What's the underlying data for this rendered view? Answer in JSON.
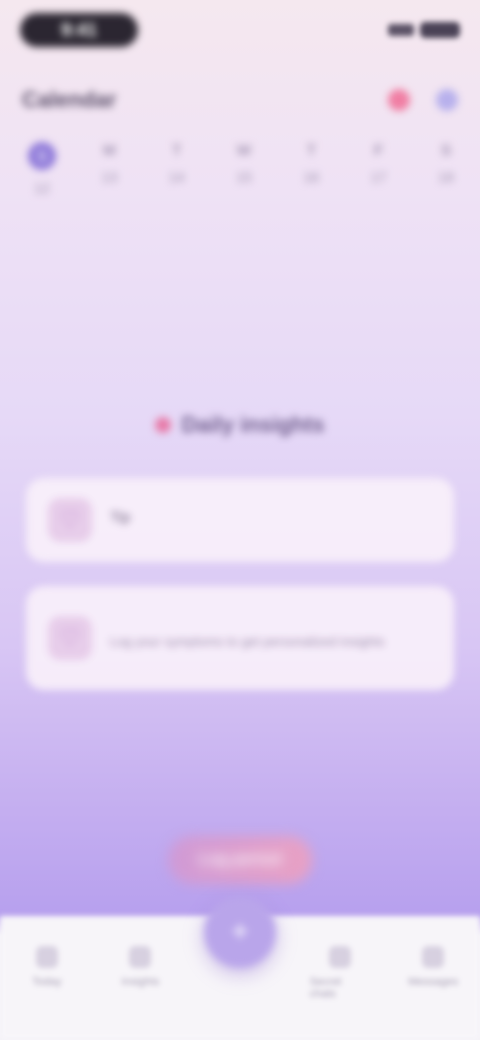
{
  "status_bar": {
    "time": "9:41"
  },
  "header": {
    "title": "Calendar"
  },
  "week": [
    {
      "letter": "S",
      "number": "12"
    },
    {
      "letter": "M",
      "number": "13"
    },
    {
      "letter": "T",
      "number": "14"
    },
    {
      "letter": "W",
      "number": "15"
    },
    {
      "letter": "T",
      "number": "16"
    },
    {
      "letter": "F",
      "number": "17"
    },
    {
      "letter": "S",
      "number": "18"
    }
  ],
  "section": {
    "title": "Daily insights"
  },
  "cards": [
    {
      "title": "Tip",
      "subtitle": ""
    },
    {
      "title": "",
      "subtitle": "Log your symptoms to get personalized insights"
    }
  ],
  "cta": {
    "label": "Log period"
  },
  "tabs": [
    {
      "label": "Today"
    },
    {
      "label": "Insights"
    },
    {
      "label": "Secret chats"
    },
    {
      "label": "Messages"
    }
  ]
}
